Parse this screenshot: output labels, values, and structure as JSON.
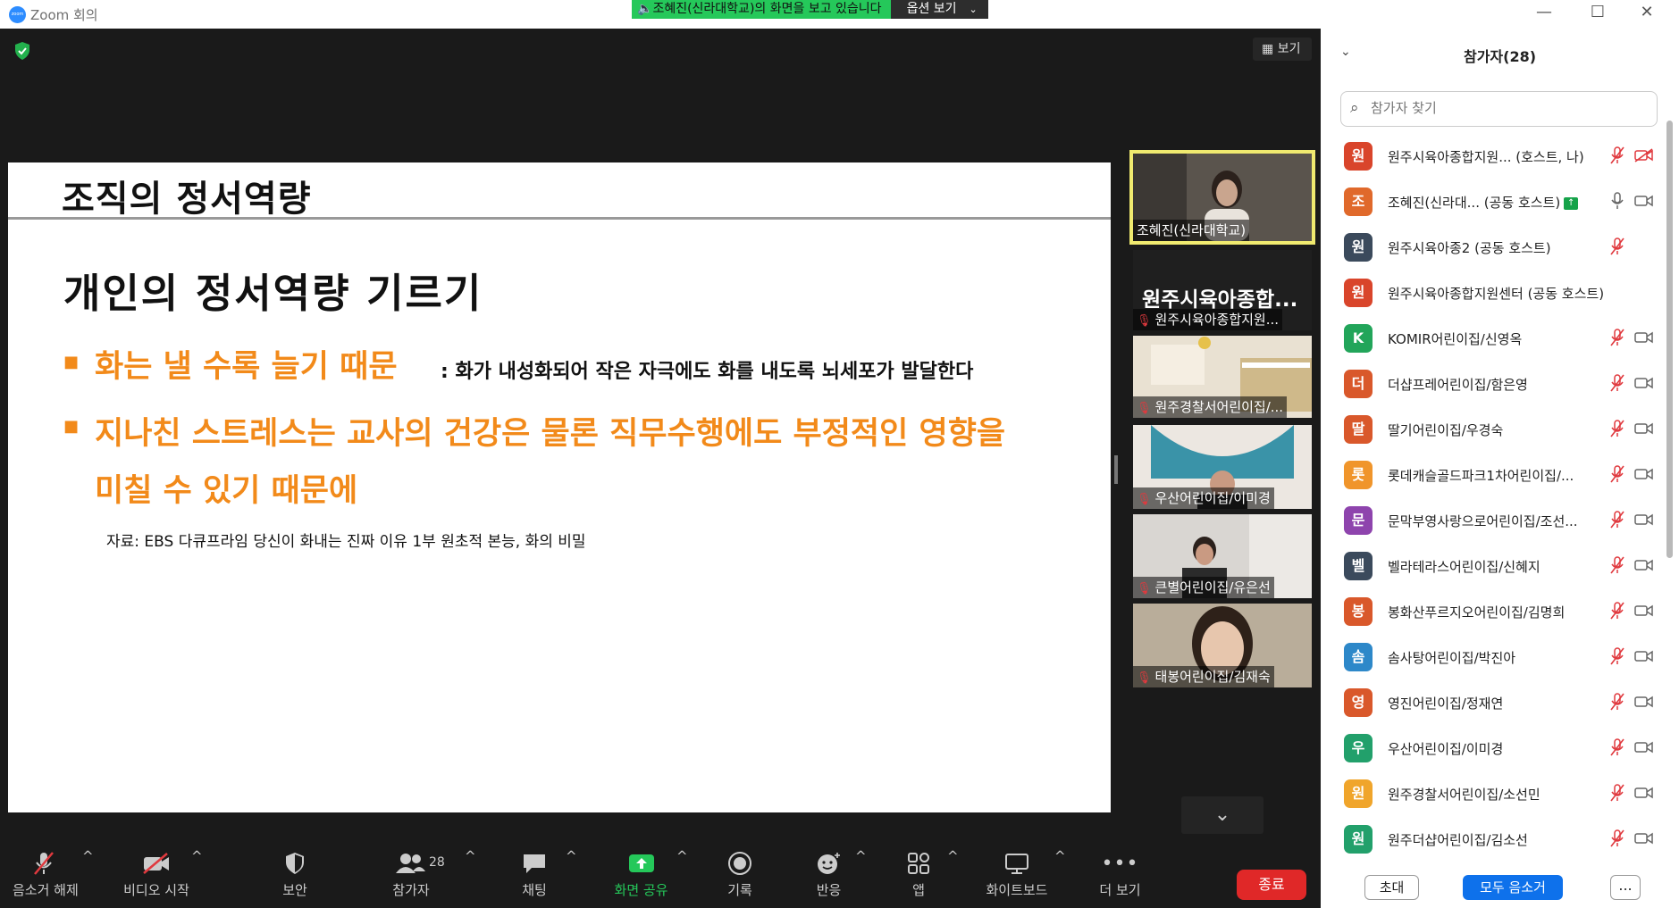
{
  "window": {
    "title": "Zoom 회의",
    "app_icon_text": "zoom",
    "share_banner": "조혜진(신라대학교)의 화면을 보고 있습니다",
    "view_options": "옵션 보기",
    "controls": [
      "minimize",
      "maximize",
      "close"
    ]
  },
  "meeting": {
    "view_label": "보기",
    "slide": {
      "title": "조직의 정서역량",
      "heading": "개인의 정서역량 기르기",
      "bullets": [
        {
          "main": "화는 낼 수록 늘기 때문",
          "rest": ": 화가 내성화되어 작은 자극에도 화를 내도록 뇌세포가 발달한다"
        },
        {
          "main": "지나친 스트레스는 교사의 건강은 물론 직무수행에도 부정적인 영향을 미칠 수 있기 때문에",
          "rest": ""
        }
      ],
      "source": "자료: EBS 다큐프라임 당신이 화내는 진짜 이유 1부 원초적 본능, 화의 비밀"
    },
    "gallery": [
      {
        "name": "조혜진(신라대학교)",
        "muted": false,
        "speaking": true
      },
      {
        "name": "원주시육아종합지원...",
        "big_name": "원주시육아종합...",
        "muted": true,
        "speaking": false
      },
      {
        "name": "원주경찰서어린이집/...",
        "muted": true,
        "speaking": false
      },
      {
        "name": "우산어린이집/이미경",
        "muted": true,
        "speaking": false
      },
      {
        "name": "큰별어린이집/유은선",
        "muted": true,
        "speaking": false
      },
      {
        "name": "태봉어린이집/김재숙",
        "muted": true,
        "speaking": false
      }
    ]
  },
  "toolbar": {
    "unmute": "음소거 해제",
    "video": "비디오 시작",
    "security": "보안",
    "participants": "참가자",
    "participants_count": "28",
    "chat": "채팅",
    "share": "화면 공유",
    "record": "기록",
    "reactions": "반응",
    "apps": "앱",
    "whiteboard": "화이트보드",
    "more": "더 보기",
    "end": "종료"
  },
  "panel": {
    "title": "참가자(28)",
    "search_placeholder": "참가자 찾기",
    "participants": [
      {
        "initial": "원",
        "name": "원주시육아종합지원... (호스트, 나)",
        "color": "#d9452b",
        "mic": "muted",
        "cam": "off"
      },
      {
        "initial": "조",
        "name": "조혜진(신라대... (공동 호스트)",
        "color": "#e0692b",
        "mic": "on",
        "cam": "on",
        "sharing": true
      },
      {
        "initial": "원",
        "name": "원주시육아종2 (공동 호스트)",
        "color": "#3b4a5c",
        "mic": "muted",
        "cam": "none"
      },
      {
        "initial": "원",
        "name": "원주시육아종합지원센터 (공동 호스트)",
        "color": "#d9452b",
        "mic": "none",
        "cam": "none"
      },
      {
        "initial": "K",
        "name": "KOMIR어린이집/신영옥",
        "color": "#22a55a",
        "mic": "muted",
        "cam": "on"
      },
      {
        "initial": "더",
        "name": "더샵프레어린이집/함은영",
        "color": "#d9582b",
        "mic": "muted",
        "cam": "on"
      },
      {
        "initial": "딸",
        "name": "딸기어린이집/우경숙",
        "color": "#d9582b",
        "mic": "muted",
        "cam": "on"
      },
      {
        "initial": "롯",
        "name": "롯데캐슬골드파크1차어린이집/...",
        "color": "#f0952b",
        "mic": "muted",
        "cam": "on"
      },
      {
        "initial": "문",
        "name": "문막부영사랑으로어린이집/조선...",
        "color": "#8e44ad",
        "mic": "muted",
        "cam": "on"
      },
      {
        "initial": "벨",
        "name": "벨라테라스어린이집/신혜지",
        "color": "#3b4a5c",
        "mic": "muted",
        "cam": "on"
      },
      {
        "initial": "봉",
        "name": "봉화산푸르지오어린이집/김명희",
        "color": "#d9582b",
        "mic": "muted",
        "cam": "on"
      },
      {
        "initial": "솜",
        "name": "솜사탕어린이집/박진아",
        "color": "#2d88c9",
        "mic": "muted",
        "cam": "on"
      },
      {
        "initial": "영",
        "name": "영진어린이집/정재연",
        "color": "#d9582b",
        "mic": "muted",
        "cam": "on"
      },
      {
        "initial": "우",
        "name": "우산어린이집/이미경",
        "color": "#22a06b",
        "mic": "muted",
        "cam": "on"
      },
      {
        "initial": "원",
        "name": "원주경찰서어린이집/소선민",
        "color": "#f0a52b",
        "mic": "muted",
        "cam": "on"
      },
      {
        "initial": "원",
        "name": "원주더샵어린이집/김소선",
        "color": "#22a06b",
        "mic": "muted",
        "cam": "on"
      }
    ],
    "invite": "초대",
    "mute_all": "모두 음소거",
    "more": "..."
  }
}
